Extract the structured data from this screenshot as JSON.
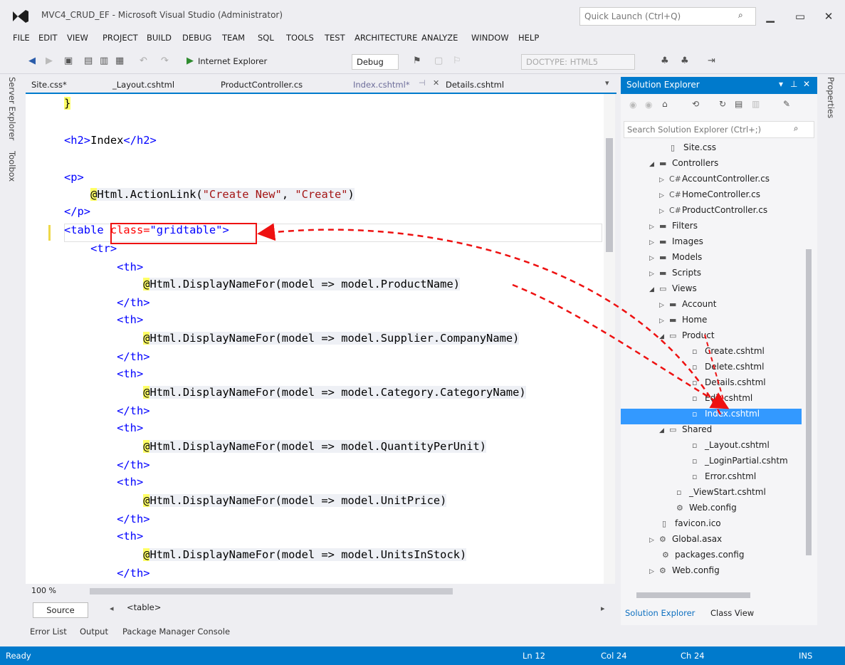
{
  "window": {
    "title": "MVC4_CRUD_EF - Microsoft Visual Studio (Administrator)",
    "quick_launch_placeholder": "Quick Launch (Ctrl+Q)"
  },
  "menu": [
    "FILE",
    "EDIT",
    "VIEW",
    "PROJECT",
    "BUILD",
    "DEBUG",
    "TEAM",
    "SQL",
    "TOOLS",
    "TEST",
    "ARCHITECTURE",
    "ANALYZE",
    "WINDOW",
    "HELP"
  ],
  "toolbar": {
    "browser": "Internet Explorer",
    "config": "Debug",
    "doctype": "DOCTYPE: HTML5"
  },
  "left_strips": [
    "Server Explorer",
    "Toolbox"
  ],
  "right_strip": "Properties",
  "tabs": [
    "Site.css*",
    "_Layout.cshtml",
    "ProductController.cs",
    "Index.cshtml*",
    "Details.cshtml"
  ],
  "active_tab_index": 3,
  "code": {
    "l1": "}",
    "l2_open": "<h2>",
    "l2_text": "Index",
    "l2_close": "</h2>",
    "l3_open": "<p>",
    "l4_razor": "@",
    "l4_method": "Html.ActionLink(",
    "l4_arg1": "\"Create New\"",
    "l4_sep": ", ",
    "l4_arg2": "\"Create\"",
    "l4_end": ")",
    "l5_close": "</p>",
    "l6_tag": "<table",
    "l6_attr": "class=",
    "l6_val": "\"gridtable\"",
    "l6_end": ">",
    "l7": "<tr>",
    "th_open": "<th>",
    "th_close": "</th>",
    "razor": "@",
    "th1": "Html.DisplayNameFor(model => model.ProductName)",
    "th2": "Html.DisplayNameFor(model => model.Supplier.CompanyName)",
    "th3": "Html.DisplayNameFor(model => model.Category.CategoryName)",
    "th4": "Html.DisplayNameFor(model => model.QuantityPerUnit)",
    "th5": "Html.DisplayNameFor(model => model.UnitPrice)",
    "th6": "Html.DisplayNameFor(model => model.UnitsInStock)"
  },
  "editor_bottom": {
    "zoom": "100 %",
    "source_button": "Source",
    "breadcrumb": "<table>"
  },
  "solution_explorer": {
    "title": "Solution Explorer",
    "search_placeholder": "Search Solution Explorer (Ctrl+;)",
    "nodes": [
      {
        "label": "Site.css",
        "icon": "css-file-icon"
      },
      {
        "label": "Controllers",
        "icon": "folder-icon"
      },
      {
        "label": "AccountController.cs",
        "icon": "csharp-file-icon"
      },
      {
        "label": "HomeController.cs",
        "icon": "csharp-file-icon"
      },
      {
        "label": "ProductController.cs",
        "icon": "csharp-file-icon"
      },
      {
        "label": "Filters",
        "icon": "folder-icon"
      },
      {
        "label": "Images",
        "icon": "folder-icon"
      },
      {
        "label": "Models",
        "icon": "folder-icon"
      },
      {
        "label": "Scripts",
        "icon": "folder-icon"
      },
      {
        "label": "Views",
        "icon": "folder-icon"
      },
      {
        "label": "Account",
        "icon": "folder-icon"
      },
      {
        "label": "Home",
        "icon": "folder-icon"
      },
      {
        "label": "Product",
        "icon": "folder-icon"
      },
      {
        "label": "Create.cshtml",
        "icon": "razor-file-icon"
      },
      {
        "label": "Delete.cshtml",
        "icon": "razor-file-icon"
      },
      {
        "label": "Details.cshtml",
        "icon": "razor-file-icon"
      },
      {
        "label": "Edit.cshtml",
        "icon": "razor-file-icon"
      },
      {
        "label": "Index.cshtml",
        "icon": "razor-file-icon"
      },
      {
        "label": "Shared",
        "icon": "folder-icon"
      },
      {
        "label": "_Layout.cshtml",
        "icon": "razor-file-icon"
      },
      {
        "label": "_LoginPartial.cshtm",
        "icon": "razor-file-icon"
      },
      {
        "label": "Error.cshtml",
        "icon": "razor-file-icon"
      },
      {
        "label": "_ViewStart.cshtml",
        "icon": "razor-file-icon"
      },
      {
        "label": "Web.config",
        "icon": "config-file-icon"
      },
      {
        "label": "favicon.ico",
        "icon": "file-icon"
      },
      {
        "label": "Global.asax",
        "icon": "config-file-icon"
      },
      {
        "label": "packages.config",
        "icon": "config-file-icon"
      },
      {
        "label": "Web.config",
        "icon": "config-file-icon"
      }
    ],
    "selected": "Index.cshtml",
    "bottom_tabs": [
      "Solution Explorer",
      "Class View"
    ]
  },
  "bottom_tabs": [
    "Error List",
    "Output",
    "Package Manager Console"
  ],
  "status": {
    "state": "Ready",
    "ln": "Ln 12",
    "col": "Col 24",
    "ch": "Ch 24",
    "mode": "INS"
  },
  "colors": {
    "accent": "#007acc",
    "annotation": "#e11111"
  }
}
